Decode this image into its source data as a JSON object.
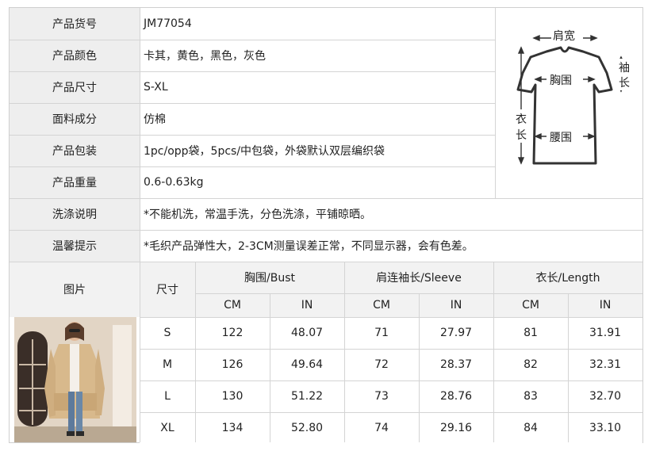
{
  "info_rows": [
    {
      "label": "产品货号",
      "value": "JM77054"
    },
    {
      "label": "产品颜色",
      "value": "卡其，黄色，黑色，灰色"
    },
    {
      "label": "产品尺寸",
      "value": "S-XL"
    },
    {
      "label": "面料成分",
      "value": "仿棉"
    },
    {
      "label": "产品包装",
      "value": "1pc/opp袋，5pcs/中包袋，外袋默认双层编织袋"
    },
    {
      "label": "产品重量",
      "value": "0.6-0.63kg"
    },
    {
      "label": "洗涤说明",
      "value": "*不能机洗，常温手洗，分色洗涤，平铺晾晒。"
    },
    {
      "label": "温馨提示",
      "value": "*毛织产品弹性大，2-3CM测量误差正常，不同显示器，会有色差。"
    }
  ],
  "diagram": {
    "shoulder": "肩宽",
    "sleeve_1": "袖",
    "sleeve_2": "长",
    "chest": "胸围",
    "length_1": "衣",
    "length_2": "长",
    "waist": "腰围"
  },
  "size_table": {
    "photo_label": "图片",
    "size_label": "尺寸",
    "groups": [
      "胸围/Bust",
      "肩连袖长/Sleeve",
      "衣长/Length"
    ],
    "units": [
      "CM",
      "IN",
      "CM",
      "IN",
      "CM",
      "IN"
    ],
    "rows": [
      {
        "size": "S",
        "values": [
          "122",
          "48.07",
          "71",
          "27.97",
          "81",
          "31.91"
        ]
      },
      {
        "size": "M",
        "values": [
          "126",
          "49.64",
          "72",
          "28.37",
          "82",
          "32.31"
        ]
      },
      {
        "size": "L",
        "values": [
          "130",
          "51.22",
          "73",
          "28.76",
          "83",
          "32.70"
        ]
      },
      {
        "size": "XL",
        "values": [
          "134",
          "52.80",
          "74",
          "29.16",
          "84",
          "33.10"
        ]
      }
    ]
  }
}
